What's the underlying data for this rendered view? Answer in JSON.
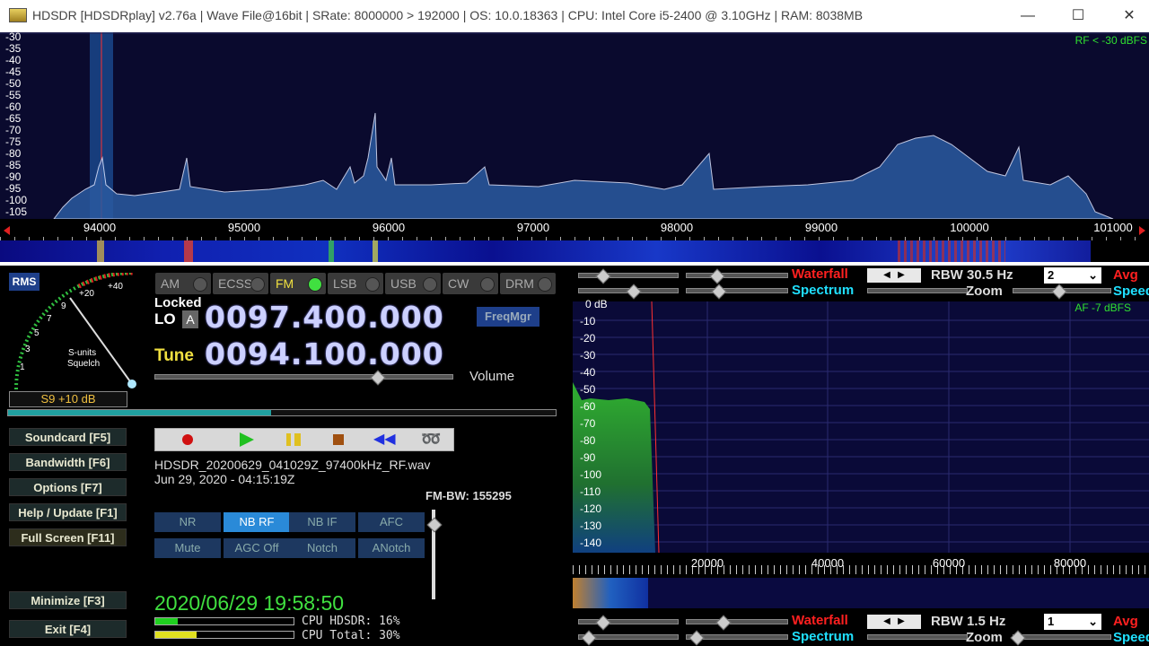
{
  "titlebar": {
    "title": "HDSDR  [HDSDRplay]  v2.76a  |  Wave File@16bit  |  SRate: 8000000 > 192000  |  OS: 10.0.18363   |  CPU: Intel Core i5-2400 @ 3.10GHz  |  RAM: 8038MB",
    "minimize": "—",
    "maximize": "☐",
    "close": "✕"
  },
  "rf_spectrum": {
    "indicator": "RF < -30 dBFS",
    "db_labels": [
      "-30",
      "-35",
      "-40",
      "-45",
      "-50",
      "-55",
      "-60",
      "-65",
      "-70",
      "-75",
      "-80",
      "-85",
      "-90",
      "-95",
      "-100",
      "-105"
    ],
    "freq_labels": [
      "94000",
      "95000",
      "96000",
      "97000",
      "98000",
      "99000",
      "100000",
      "101000"
    ]
  },
  "smeter": {
    "rms_label": "RMS",
    "scale": [
      "1",
      "3",
      "5",
      "7",
      "9",
      "+20",
      "+40"
    ],
    "center_label_1": "S-units",
    "center_label_2": "Squelch",
    "reading": "S9 +10 dB"
  },
  "side_buttons": {
    "soundcard": "Soundcard  [F5]",
    "bandwidth": "Bandwidth  [F6]",
    "options": "Options  [F7]",
    "help": "Help / Update  [F1]",
    "fullscreen": "Full Screen  [F11]",
    "minimize": "Minimize  [F3]",
    "exit": "Exit  [F4]"
  },
  "modes": [
    "AM",
    "ECSS",
    "FM",
    "LSB",
    "USB",
    "CW",
    "DRM"
  ],
  "active_mode": "FM",
  "lo": {
    "locked": "Locked",
    "label": "LO",
    "a_label": "A",
    "value": "0097.400.000"
  },
  "tune": {
    "label": "Tune",
    "value": "0094.100.000"
  },
  "freqmgr": "FreqMgr",
  "volume_label": "Volume",
  "transport": {
    "filename": "HDSDR_20200629_041029Z_97400kHz_RF.wav",
    "filetime": "Jun 29, 2020 - 04:15:19Z"
  },
  "fm_bw": "FM-BW: 155295",
  "dsp_buttons": {
    "nr": "NR",
    "nbrf": "NB RF",
    "nbif": "NB IF",
    "afc": "AFC",
    "mute": "Mute",
    "agc": "AGC Off",
    "notch": "Notch",
    "anotch": "ANotch"
  },
  "clock": "2020/06/29 19:58:50",
  "cpu": {
    "hdsdr": "CPU HDSDR:  16%",
    "total": "CPU Total:  30%",
    "hdsdr_pct": 16,
    "total_pct": 30
  },
  "rf_controls": {
    "waterfall": "Waterfall",
    "spectrum": "Spectrum",
    "rbw": "RBW 30.5 Hz",
    "zoom": "Zoom",
    "avg_select": "2",
    "avg": "Avg",
    "speed": "Speed"
  },
  "af_spectrum": {
    "indicator": "AF  -7 dBFS",
    "db_labels": [
      "0 dB",
      "-10",
      "-20",
      "-30",
      "-40",
      "-50",
      "-60",
      "-70",
      "-80",
      "-90",
      "-100",
      "-110",
      "-120",
      "-130",
      "-140"
    ],
    "freq_labels": [
      "20000",
      "40000",
      "60000",
      "80000"
    ]
  },
  "af_controls": {
    "waterfall": "Waterfall",
    "spectrum": "Spectrum",
    "rbw": "RBW  1.5 Hz",
    "zoom": "Zoom",
    "avg_select": "1",
    "avg": "Avg",
    "speed": "Speed"
  },
  "colors": {
    "waterfall_red": "#ff2020",
    "spectrum_cyan": "#20e0ff",
    "active_btn": "#2a8ad8",
    "clock_green": "#40e040"
  }
}
